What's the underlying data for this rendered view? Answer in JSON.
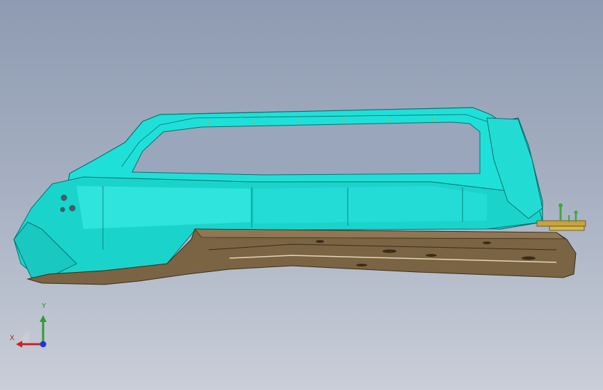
{
  "viewport": {
    "background_top": "#8e9bb2",
    "background_bottom": "#c9ced8"
  },
  "model": {
    "frame_color": "#1fe0d8",
    "frame_edge_color": "#0a6f6c",
    "sill_color": "#7a6443",
    "sill_edge_color": "#3b2c18",
    "bracket_color": "#c8a23a",
    "bracket_accent": "#3ea83a"
  },
  "triad": {
    "y_label": "Y",
    "x_label": "X",
    "y_color": "#2aa02a",
    "x_color": "#d02020",
    "z_color": "#1a3ad8"
  }
}
